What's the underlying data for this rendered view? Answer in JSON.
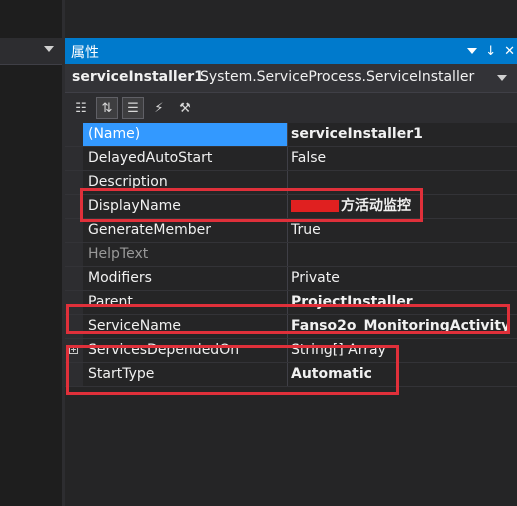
{
  "window": {
    "title": "属性",
    "pin_glyph": "↓",
    "close_glyph": "✕"
  },
  "object_selector": {
    "name": "serviceInstaller1",
    "type": "System.ServiceProcess.ServiceInstaller"
  },
  "toolbar": {
    "buttons": [
      {
        "icon": "categorized-icon",
        "glyph": "☷",
        "active": false
      },
      {
        "icon": "alphabetical-icon",
        "glyph": "⇅",
        "active": true
      },
      {
        "icon": "properties-icon",
        "glyph": "☰",
        "active": true
      },
      {
        "icon": "events-icon",
        "glyph": "⚡",
        "active": false
      },
      {
        "icon": "property-pages-icon",
        "glyph": "⚒",
        "active": false
      }
    ]
  },
  "properties": [
    {
      "name": "(Name)",
      "value": "serviceInstaller1",
      "bold": true,
      "selected": true
    },
    {
      "name": "DelayedAutoStart",
      "value": "False"
    },
    {
      "name": "Description",
      "value": ""
    },
    {
      "name": "DisplayName",
      "value": "方活动监控",
      "bold": true,
      "redacted_prefix": true
    },
    {
      "name": "GenerateMember",
      "value": "True"
    },
    {
      "name": "HelpText",
      "value": "",
      "dim": true
    },
    {
      "name": "Modifiers",
      "value": "Private"
    },
    {
      "name": "Parent",
      "value": "ProjectInstaller",
      "bold": true
    },
    {
      "name": "ServiceName",
      "value": "Fanso2o_MonitoringActivity",
      "bold": true
    },
    {
      "name": "ServicesDependedOn",
      "value": "String[] Array",
      "expandable": true
    },
    {
      "name": "StartType",
      "value": "Automatic",
      "bold": true
    }
  ],
  "annotations": {
    "color": "#e0303a",
    "boxes": [
      "DisplayName",
      "ServiceName",
      "StartType"
    ]
  }
}
